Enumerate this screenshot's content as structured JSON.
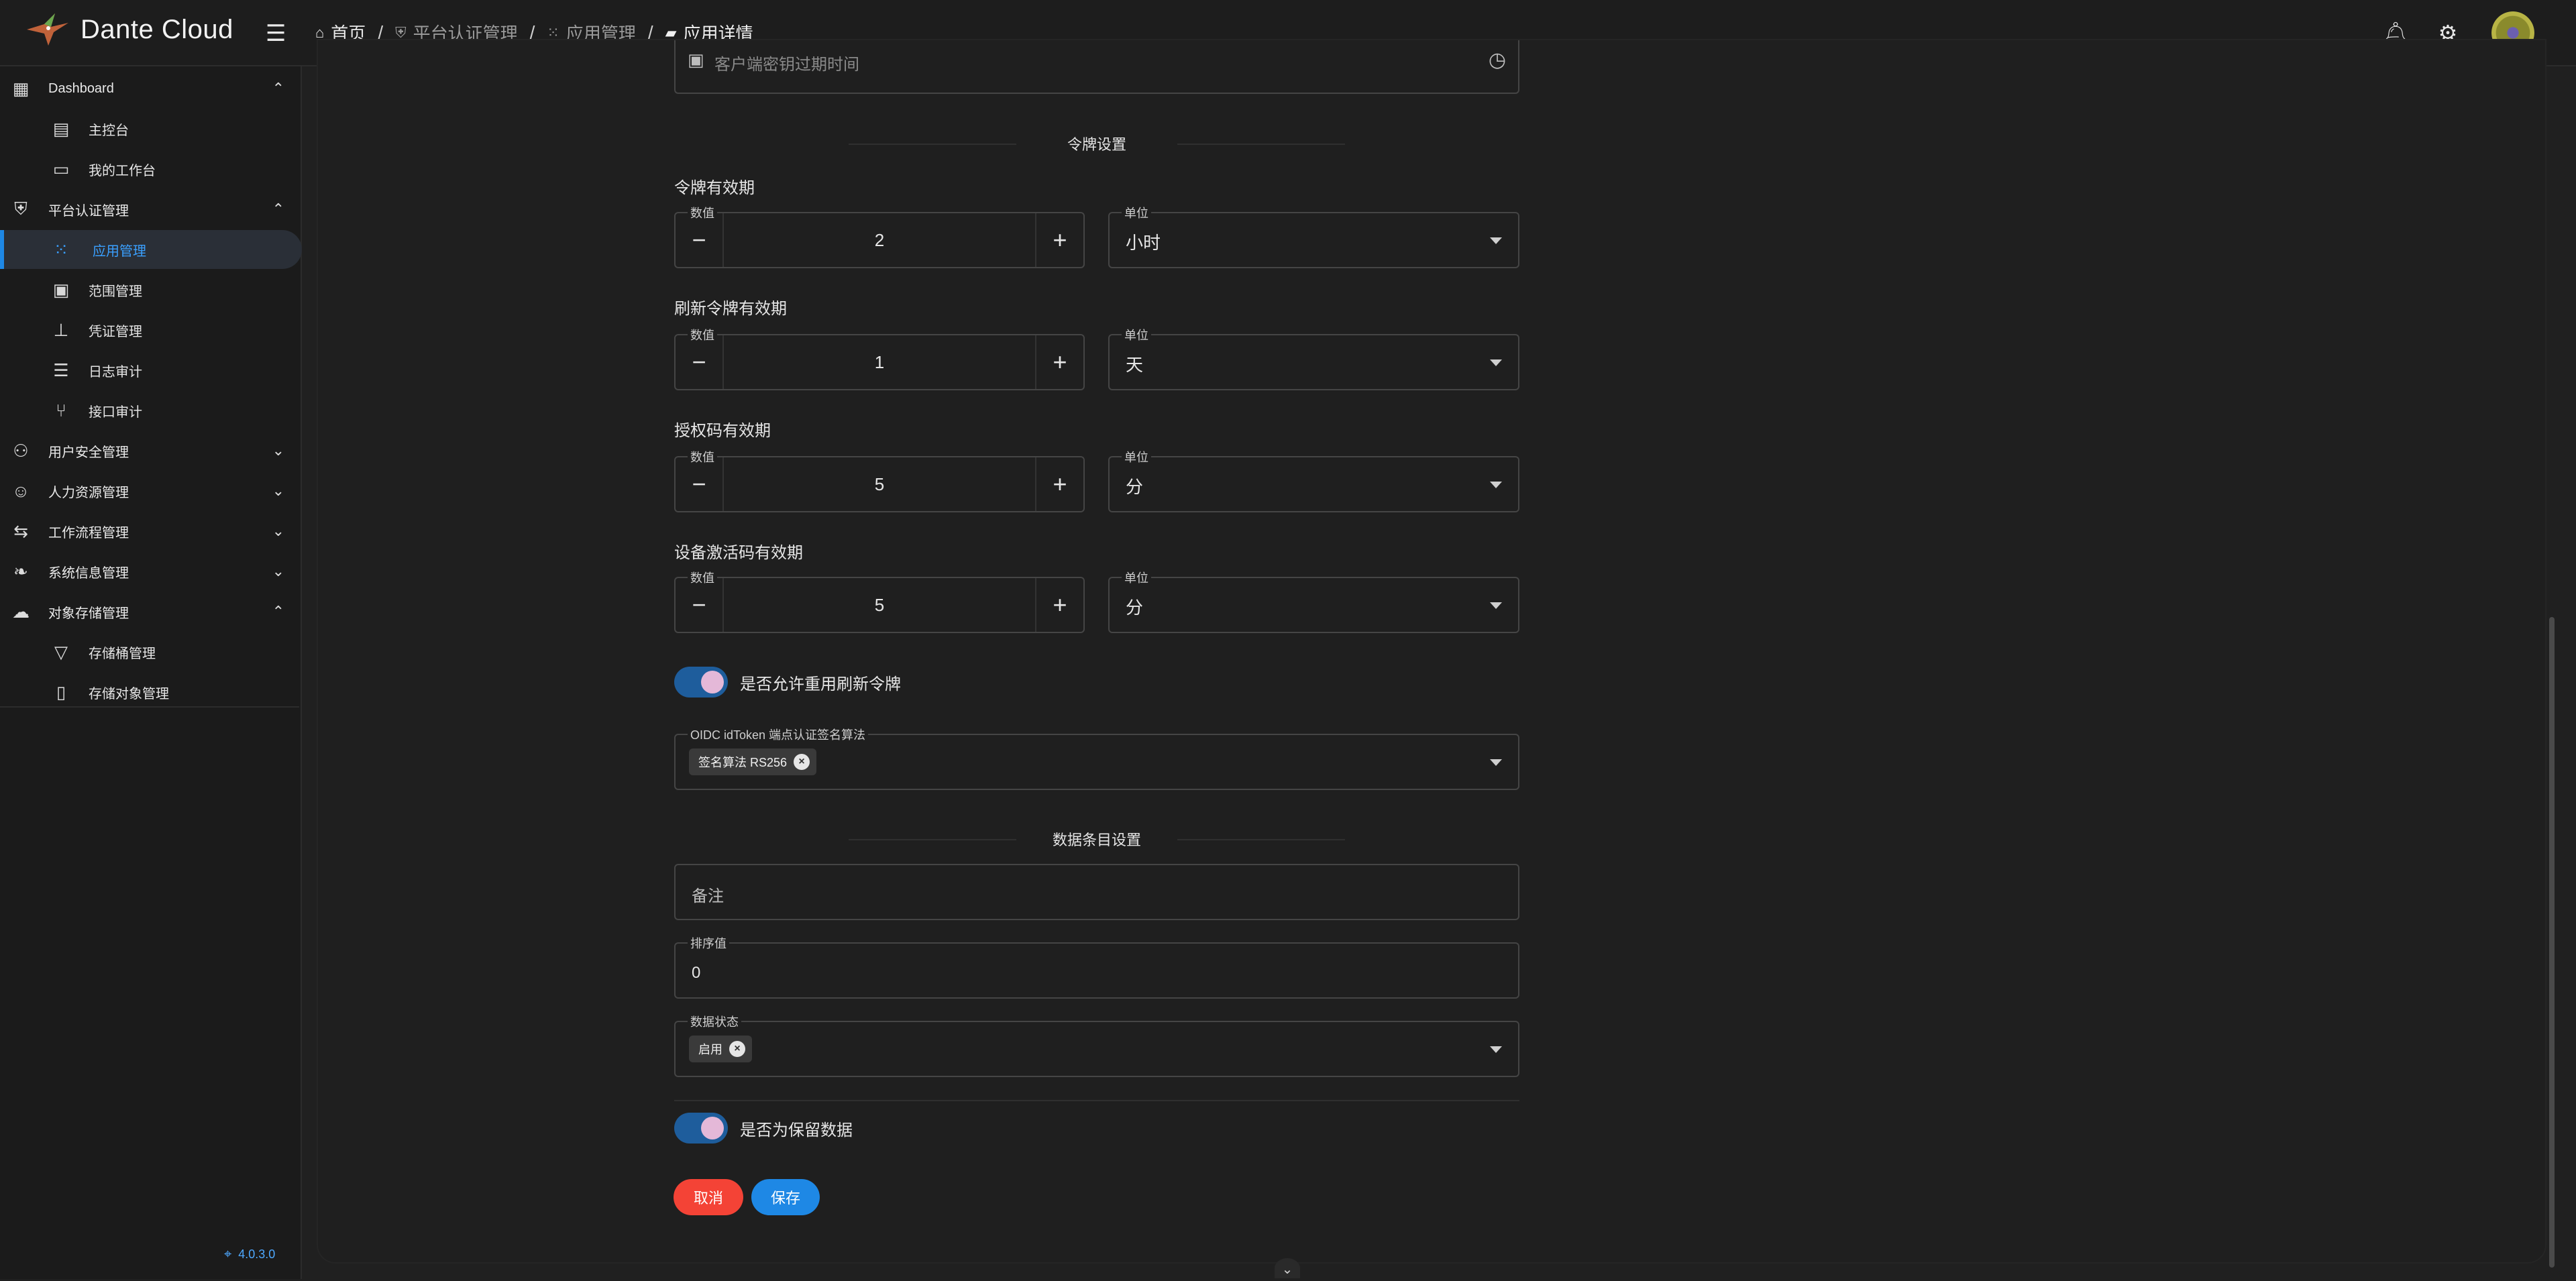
{
  "header": {
    "brand": "Dante Cloud",
    "breadcrumb": [
      {
        "label": "首页",
        "icon": "home-icon"
      },
      {
        "label": "平台认证管理",
        "icon": "shield-icon"
      },
      {
        "label": "应用管理",
        "icon": "apps-grid-icon"
      },
      {
        "label": "应用详情",
        "icon": "folder-open-icon"
      }
    ],
    "icons": [
      "bell-icon",
      "gear-icon",
      "avatar"
    ]
  },
  "sidebar": {
    "groups": [
      {
        "label": "Dashboard",
        "icon": "dashboard-icon",
        "expanded": true,
        "items": [
          {
            "label": "主控台",
            "icon": "monitor-icon"
          },
          {
            "label": "我的工作台",
            "icon": "laptop-icon"
          }
        ]
      },
      {
        "label": "平台认证管理",
        "icon": "shield-icon",
        "expanded": true,
        "items": [
          {
            "label": "应用管理",
            "icon": "apps-grid-icon",
            "active": true
          },
          {
            "label": "范围管理",
            "icon": "scope-icon"
          },
          {
            "label": "凭证管理",
            "icon": "sitemap-icon"
          },
          {
            "label": "日志审计",
            "icon": "log-icon"
          },
          {
            "label": "接口审计",
            "icon": "api-icon"
          }
        ]
      },
      {
        "label": "用户安全管理",
        "icon": "user-security-icon",
        "expanded": false
      },
      {
        "label": "人力资源管理",
        "icon": "people-icon",
        "expanded": false
      },
      {
        "label": "工作流程管理",
        "icon": "workflow-icon",
        "expanded": false
      },
      {
        "label": "系统信息管理",
        "icon": "leaf-icon",
        "expanded": false
      },
      {
        "label": "对象存储管理",
        "icon": "cloud-upload-icon",
        "expanded": true,
        "items": [
          {
            "label": "存储桶管理",
            "icon": "bucket-icon"
          },
          {
            "label": "存储对象管理",
            "icon": "storage-object-icon"
          }
        ]
      }
    ],
    "version": "4.0.3.0"
  },
  "form": {
    "top_field_placeholder": "客户端密钥过期时间",
    "token_section_title": "令牌设置",
    "value_label": "数值",
    "unit_label": "单位",
    "token_validity": {
      "label": "令牌有效期",
      "value": "2",
      "unit": "小时"
    },
    "refresh_validity": {
      "label": "刷新令牌有效期",
      "value": "1",
      "unit": "天"
    },
    "auth_code_validity": {
      "label": "授权码有效期",
      "value": "5",
      "unit": "分"
    },
    "device_code_validity": {
      "label": "设备激活码有效期",
      "value": "5",
      "unit": "分"
    },
    "reuse_refresh_token": {
      "label": "是否允许重用刷新令牌",
      "on": true
    },
    "oidc_algorithm": {
      "label": "OIDC idToken 端点认证签名算法",
      "chip": "签名算法 RS256"
    },
    "data_section_title": "数据条目设置",
    "remark_placeholder": "备注",
    "ranking": {
      "label": "排序值",
      "value": "0"
    },
    "status": {
      "label": "数据状态",
      "chip": "启用"
    },
    "reserved": {
      "label": "是否为保留数据",
      "on": true
    },
    "cancel_label": "取消",
    "save_label": "保存"
  },
  "colors": {
    "accent": "#1e88e5",
    "danger": "#f44336",
    "toggle_track": "#1e5d9c",
    "toggle_knob": "#e4b8d8"
  }
}
